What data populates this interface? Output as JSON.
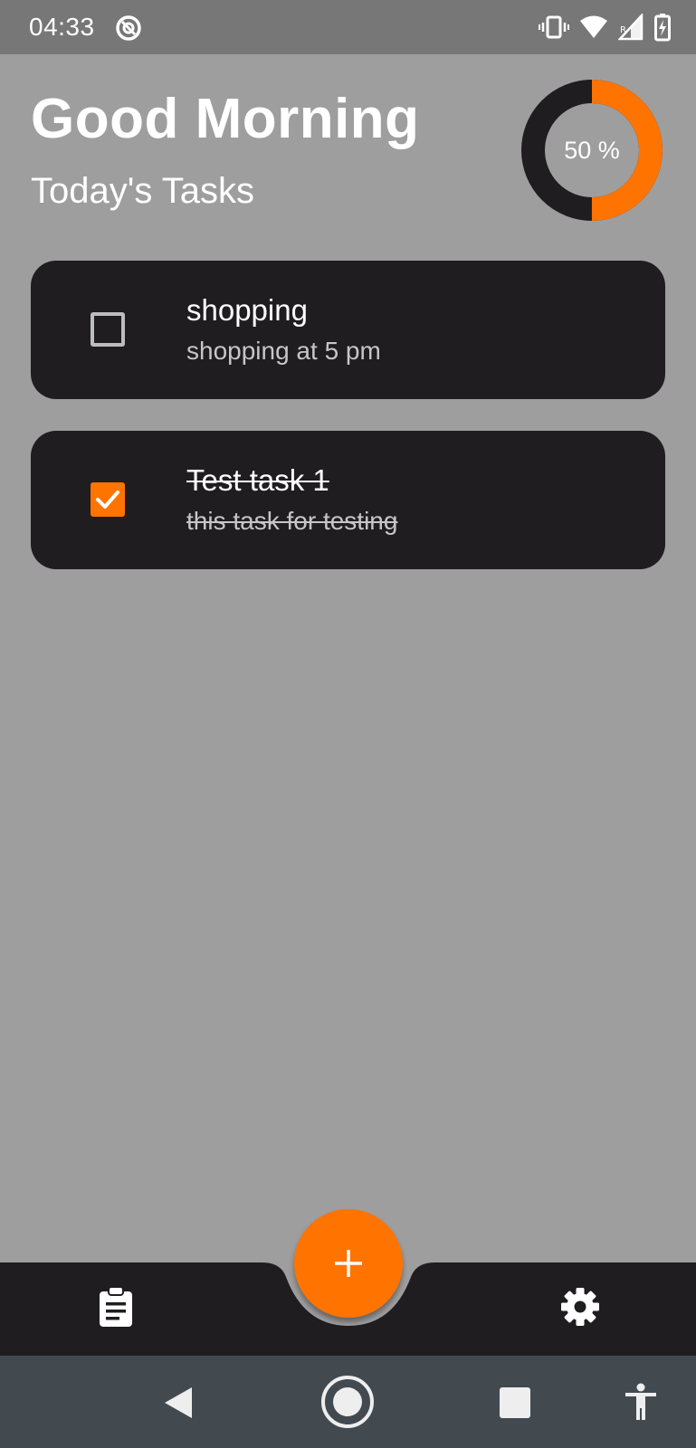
{
  "status_bar": {
    "time": "04:33",
    "icons": [
      "focus-mode-icon",
      "vibrate-icon",
      "wifi-icon",
      "signal-icon",
      "battery-charging-icon"
    ]
  },
  "header": {
    "greeting": "Good Morning",
    "subtitle": "Today's Tasks"
  },
  "progress": {
    "label": "50 %",
    "value": 0.5,
    "fill_color": "#ff7300",
    "track_color": "#1f1d20"
  },
  "tasks": [
    {
      "title": "shopping",
      "description": "shopping at 5 pm",
      "completed": false
    },
    {
      "title": "Test task 1",
      "description": "this task for testing",
      "completed": true
    }
  ],
  "bottom_nav": {
    "left_icon": "clipboard-tasks-icon",
    "right_icon": "settings-gear-icon",
    "fab_icon": "plus-icon"
  },
  "system_nav": {
    "icons": [
      "back-icon",
      "home-icon",
      "recents-icon",
      "accessibility-icon"
    ]
  },
  "colors": {
    "accent": "#ff7300",
    "card": "#1f1d20",
    "background": "#9e9e9e"
  }
}
